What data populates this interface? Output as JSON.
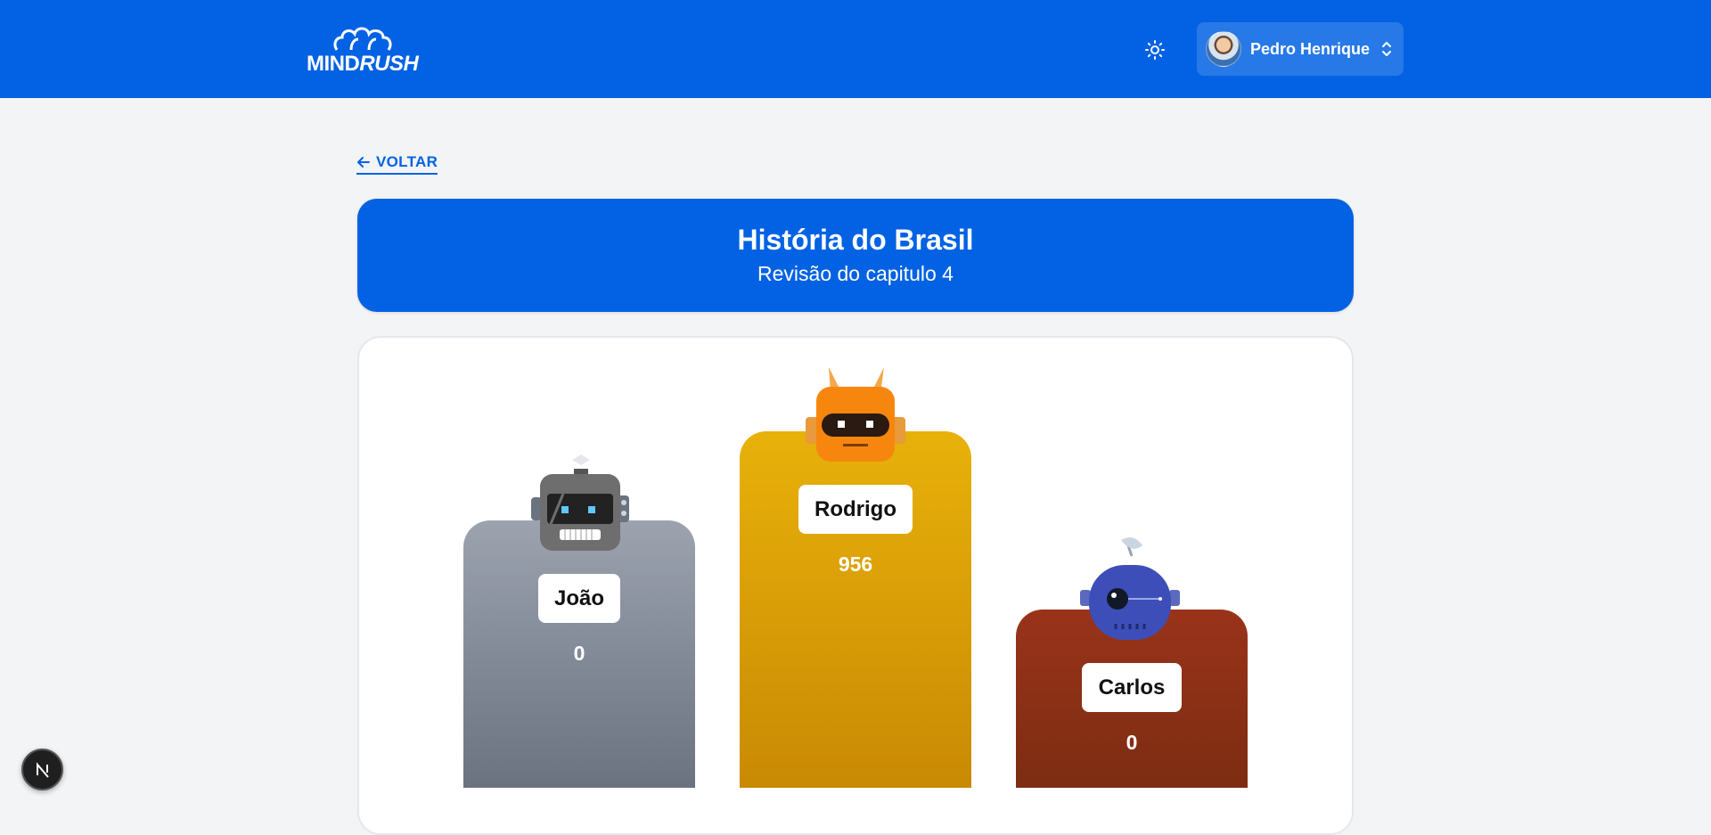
{
  "header": {
    "logo_prefix": "MIND",
    "logo_suffix": "RUSH",
    "theme_icon": "sun-icon",
    "user_name": "Pedro Henrique",
    "user_menu_icon": "chevron-up-down-icon"
  },
  "back": {
    "label": "VOLTAR",
    "icon": "arrow-left-icon"
  },
  "quiz": {
    "title": "História do Brasil",
    "subtitle": "Revisão do capitulo 4"
  },
  "podium": [
    {
      "place": 2,
      "name": "João",
      "score": "0",
      "color": "#9ca3af",
      "robot": "gray-robot-icon"
    },
    {
      "place": 1,
      "name": "Rodrigo",
      "score": "956",
      "color": "#e8b10a",
      "robot": "orange-robot-icon"
    },
    {
      "place": 3,
      "name": "Carlos",
      "score": "0",
      "color": "#99331a",
      "robot": "blue-robot-icon"
    }
  ],
  "colors": {
    "brand": "#0262e3",
    "background": "#f3f4f6"
  },
  "dev_badge": {
    "label": "N"
  }
}
